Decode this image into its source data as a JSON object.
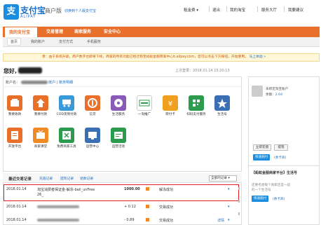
{
  "header": {
    "logo_char": "支",
    "logo_cn": "支付宝",
    "logo_en": "ALIPAY",
    "edition": "商户版",
    "switch_link": "切换到个人版支付宝",
    "top_links": [
      "租金费 ▾",
      "退出",
      "我的淘宝",
      "服务大厅",
      "我要建议"
    ]
  },
  "nav": {
    "items": [
      {
        "label": "我的支付宝",
        "active": true
      },
      {
        "label": "交易管理",
        "active": false
      },
      {
        "label": "商家服务",
        "active": false
      },
      {
        "label": "安全中心",
        "active": false
      }
    ]
  },
  "subnav": {
    "items": [
      {
        "label": "首页",
        "active": true
      },
      {
        "label": "我的账户"
      },
      {
        "label": "支付方式"
      },
      {
        "label": "手机服务"
      }
    ]
  },
  "notice": {
    "text": "亲：由于系统升级，商户数字台即将下线，商家的所有功能已经迁移至蚂蚁金服商家中心b.alipay.com，您可以点击下方按钮，开始使用。",
    "link": "马上体验 »"
  },
  "greeting": {
    "label": "您好,",
    "last_login": "上次登录：2018.01.14 15:20:13"
  },
  "account_row": {
    "prefix": "账户名：",
    "suffix_link": "账户",
    "sep": "|",
    "manage_link": "账务明细"
  },
  "icons_row1": [
    {
      "name": "balance-recharge-icon",
      "label": "我要收款",
      "color": "#e8702a"
    },
    {
      "name": "transfer-icon",
      "label": "我要付款",
      "color": "#e8702a"
    },
    {
      "name": "cod-icon",
      "label": "COD货到付款",
      "color": "#3a9ad9"
    },
    {
      "name": "credit-icon",
      "label": "信贷",
      "color": "#e8702a"
    },
    {
      "name": "life-service-icon",
      "label": "生活服务",
      "color": "#8a5ab8"
    },
    {
      "name": "taobao-promo-icon",
      "label": "一淘推广",
      "color": "#ffffff"
    },
    {
      "name": "yuebao-icon",
      "label": "转付卡",
      "color": "#f0a020"
    },
    {
      "name": "scan-service-icon",
      "label": "扫码支付服务",
      "color": "#2d9b4d"
    },
    {
      "name": "star-icon",
      "label": "生活号",
      "color": "#3a6fb5"
    }
  ],
  "icons_row2": [
    {
      "name": "open-platform-icon",
      "label": "开放平台",
      "color": "#e8702a"
    },
    {
      "name": "tv-icon",
      "label": "商家课堂",
      "color": "#f08a24"
    },
    {
      "name": "free-tool-icon",
      "label": "免费商家工具",
      "color": "#2d9b4d"
    },
    {
      "name": "ops-center-icon",
      "label": "运营中心",
      "color": "#3a6fb5"
    },
    {
      "name": "marketing-icon",
      "label": "运营活动",
      "color": "#2d9b4d"
    }
  ],
  "side": {
    "greeting_line": "未绑定淘宝账户",
    "balance_label": "余额：",
    "balance_value": "2.04",
    "recharge_btn": "立即充值",
    "withdraw_btn": "提现",
    "insured_badge": "快速赔付",
    "insured_text": "(余卡商)",
    "ad_title": "【蚂蚁金服商家平台】生活号",
    "ad_sub": "还要考虑每个商家还是一段",
    "ad_desc": "的一个生活号"
  },
  "trades": {
    "tabs": [
      "最近交易记录",
      "充值记录",
      "提现记录",
      "退款记录"
    ],
    "select": "全部的记录",
    "rows": [
      {
        "date": "2018.01.14",
        "desc": "淘宝消费者保证金-解冻-ball_unFree",
        "desc2": "26_",
        "amount": "1000.00",
        "status": "解冻成功",
        "highlight": true
      },
      {
        "date": "2018.01.14",
        "desc": "",
        "desc2": "",
        "amount": "+ 0.12",
        "status": "交易成功",
        "highlight": false
      },
      {
        "date": "2018.01.14",
        "desc": "",
        "desc2": "",
        "amount": "- 0.89",
        "status": "交易成功",
        "highlight": false
      }
    ],
    "detail_link": "详情"
  }
}
